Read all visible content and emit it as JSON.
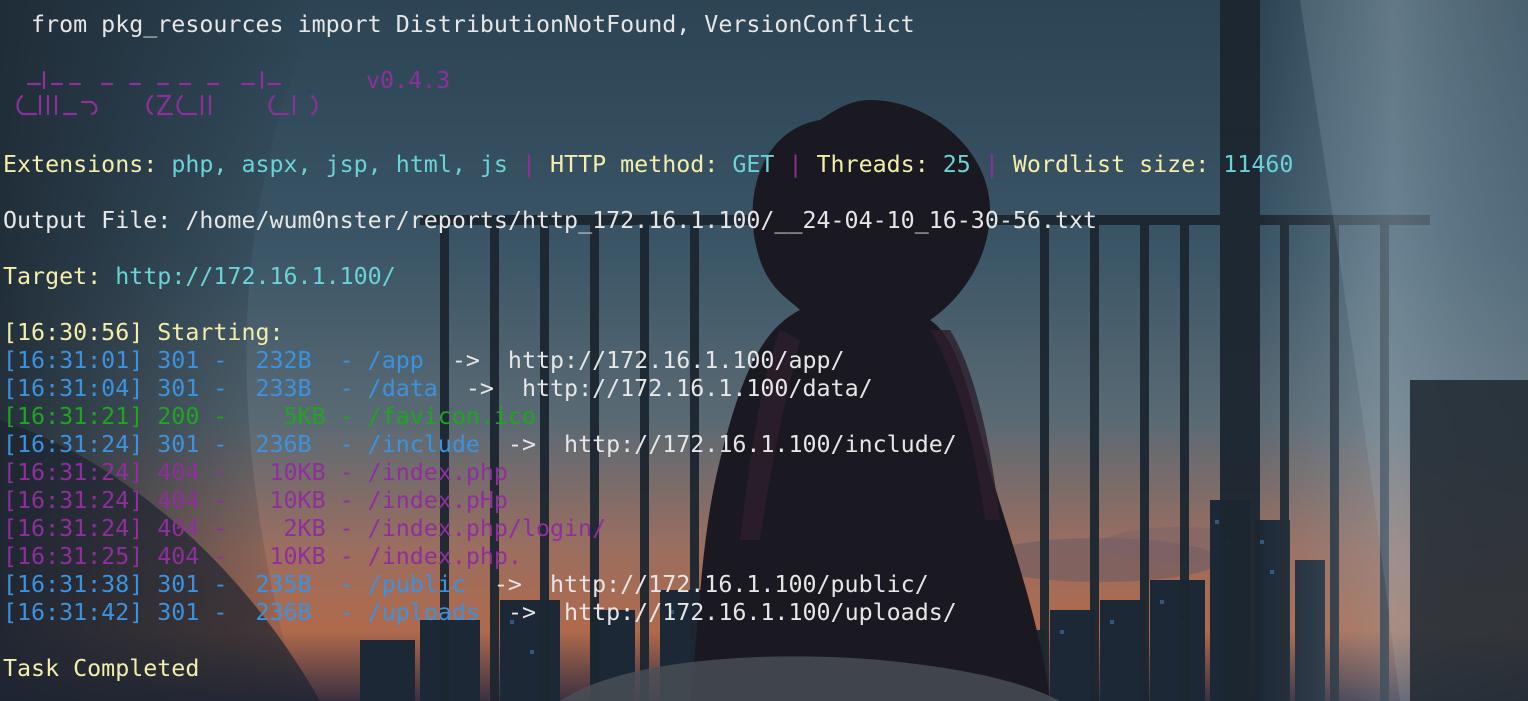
{
  "colors": {
    "white": "#e6e6e6",
    "yellow": "#f3eeaa",
    "cyan": "#6ad3d6",
    "purple": "#8e2f9c",
    "blue": "#3b93e0",
    "green": "#1fa51f"
  },
  "warning_line": "  from pkg_resources import DistributionNotFound, VersionConflict",
  "banner": {
    "logo_text": "dirsearch",
    "version": "v0.4.3"
  },
  "config": {
    "extensions_label": "Extensions: ",
    "extensions_value": "php, aspx, jsp, html, js",
    "sep1": " | ",
    "method_label": "HTTP method: ",
    "method_value": "GET",
    "sep2": " | ",
    "threads_label": "Threads: ",
    "threads_value": "25",
    "sep3": " | ",
    "wordlist_label": "Wordlist size: ",
    "wordlist_value": "11460"
  },
  "output": {
    "label": "Output File: ",
    "value": "/home/wum0nster/reports/http_172.16.1.100/__24-04-10_16-30-56.txt"
  },
  "target": {
    "label": "Target: ",
    "value": "http://172.16.1.100/"
  },
  "start_line": "[16:30:56] Starting:",
  "results": [
    {
      "text": "[16:31:01] 301 -  232B  - /app",
      "redirect": "  ->  http://172.16.1.100/app/",
      "status": "301"
    },
    {
      "text": "[16:31:04] 301 -  233B  - /data",
      "redirect": "  ->  http://172.16.1.100/data/",
      "status": "301"
    },
    {
      "text": "[16:31:21] 200 -    5KB - /favicon.ico",
      "redirect": "",
      "status": "200"
    },
    {
      "text": "[16:31:24] 301 -  236B  - /include",
      "redirect": "  ->  http://172.16.1.100/include/",
      "status": "301"
    },
    {
      "text": "[16:31:24] 404 -   10KB - /index.php",
      "redirect": "",
      "status": "404"
    },
    {
      "text": "[16:31:24] 404 -   10KB - /index.pHp",
      "redirect": "",
      "status": "404"
    },
    {
      "text": "[16:31:24] 404 -    2KB - /index.php/login/",
      "redirect": "",
      "status": "404"
    },
    {
      "text": "[16:31:25] 404 -   10KB - /index.php.",
      "redirect": "",
      "status": "404"
    },
    {
      "text": "[16:31:38] 301 -  235B  - /public",
      "redirect": "  ->  http://172.16.1.100/public/",
      "status": "301"
    },
    {
      "text": "[16:31:42] 301 -  236B  - /uploads",
      "redirect": "  ->  http://172.16.1.100/uploads/",
      "status": "301"
    }
  ],
  "completed": "Task Completed"
}
